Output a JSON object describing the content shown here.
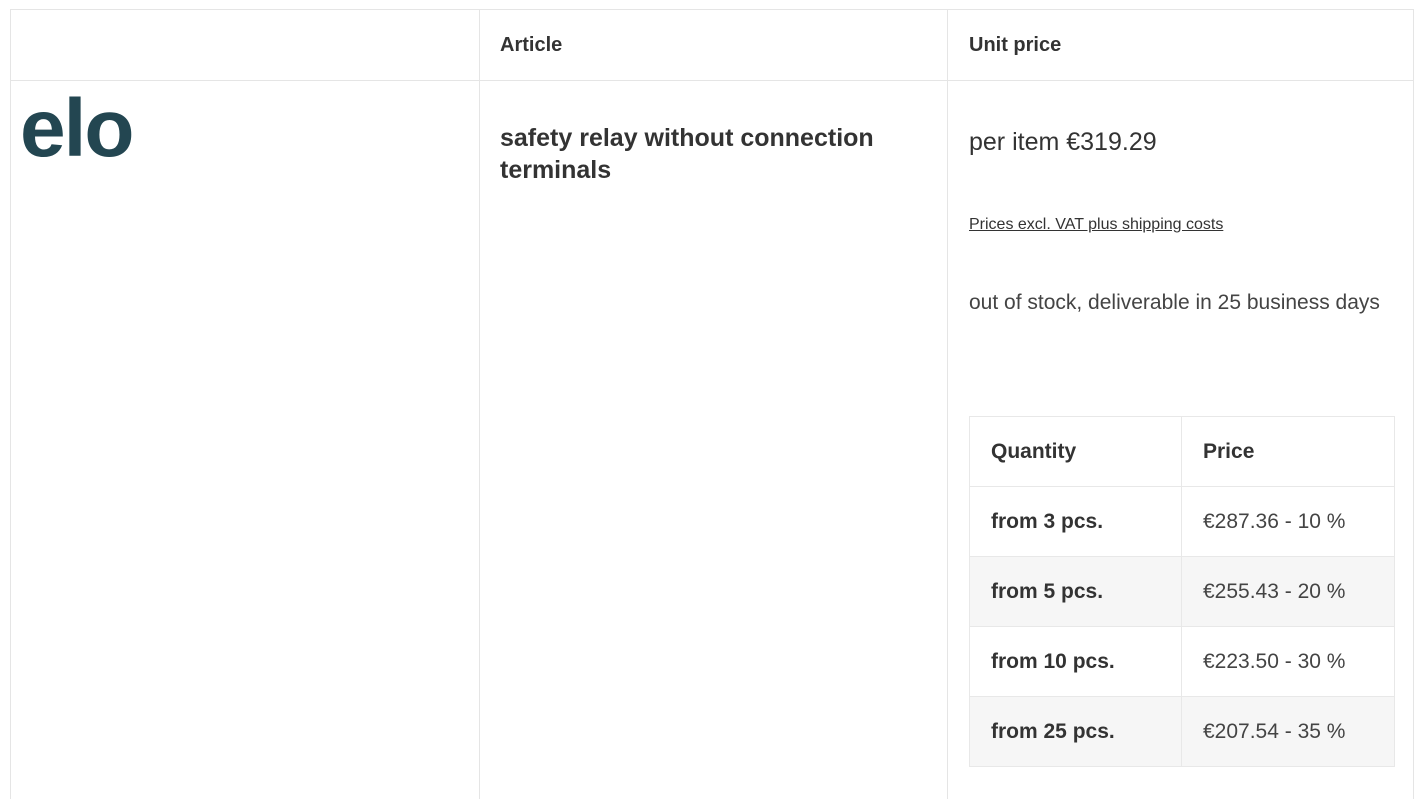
{
  "header": {
    "col1": "",
    "article": "Article",
    "unit_price": "Unit price"
  },
  "product": {
    "brand_logo": "elo",
    "name": "safety relay without connection terminals",
    "unit_price": "per item €319.29",
    "vat_note": "Prices excl. VAT plus shipping costs",
    "stock_status": "out of stock, deliverable in 25 business days"
  },
  "price_tiers": {
    "headers": {
      "quantity": "Quantity",
      "price": "Price"
    },
    "rows": [
      {
        "quantity": "from 3 pcs.",
        "price": "€287.36 - 10 %"
      },
      {
        "quantity": "from 5 pcs.",
        "price": "€255.43 - 20 %"
      },
      {
        "quantity": "from 10 pcs.",
        "price": "€223.50 - 30 %"
      },
      {
        "quantity": "from 25 pcs.",
        "price": "€207.54 - 35 %"
      }
    ]
  },
  "colors": {
    "logo": "#234651",
    "text": "#333333",
    "border": "#e5e5e5",
    "row_shade": "#f6f6f6"
  }
}
